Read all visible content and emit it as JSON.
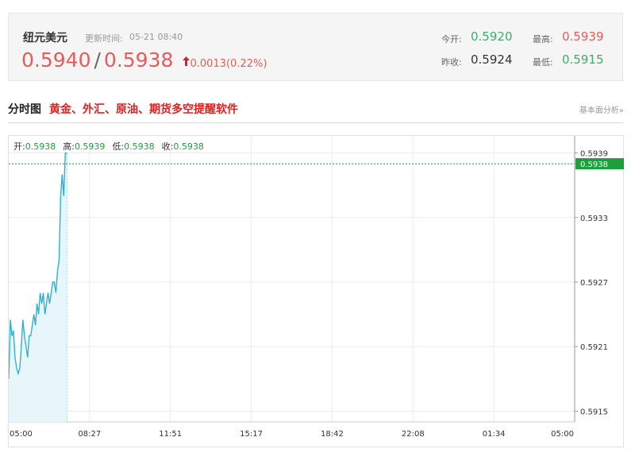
{
  "quote": {
    "name": "纽元美元",
    "update_label": "更新时间:",
    "update_time": "05-21 08:40",
    "bid": "0.5940",
    "slash": "/",
    "ask": "0.5938",
    "change": "0.0013(0.22%)",
    "direction_icon": "arrow-up-icon",
    "open_label": "今开:",
    "open": "0.5920",
    "prev_close_label": "昨收:",
    "prev_close": "0.5924",
    "high_label": "最高:",
    "high": "0.5939",
    "low_label": "最低:",
    "low": "0.5915"
  },
  "section": {
    "title": "分时图",
    "ad_text": "黄金、外汇、原油、期货多空提醒软件",
    "link": "基本面分析»"
  },
  "ohlc": {
    "open_label": "开:",
    "open": "0.5938",
    "high_label": "高:",
    "high": "0.5939",
    "low_label": "低:",
    "low": "0.5938",
    "close_label": "收:",
    "close": "0.5938"
  },
  "colors": {
    "up": "#e65c5c",
    "down": "#3dad6a",
    "line": "#2bb3d1",
    "fill": "#e6f6fb",
    "current_price_tag": "#1aa13b"
  },
  "chart_data": {
    "type": "area",
    "title": "",
    "xlabel": "",
    "ylabel": "",
    "x_ticks": [
      "05:00",
      "08:27",
      "11:51",
      "15:17",
      "18:42",
      "22:08",
      "01:34",
      "05:00"
    ],
    "y_ticks": [
      "0.5939",
      "0.5933",
      "0.5927",
      "0.5921",
      "0.5915"
    ],
    "ylim": [
      0.5914,
      0.594
    ],
    "grid": true,
    "current_price": "0.5938",
    "x_minutes": [
      0,
      4,
      8,
      12,
      16,
      20,
      24,
      28,
      32,
      36,
      40,
      44,
      48,
      52,
      56,
      60,
      64,
      68,
      72,
      76,
      80,
      84,
      88,
      92,
      96,
      100,
      104,
      108,
      112,
      116,
      120,
      124,
      128,
      132,
      136,
      140,
      144,
      148,
      152,
      156,
      160,
      164,
      168,
      172,
      176,
      180,
      184,
      188,
      192,
      196,
      200,
      204,
      208,
      212,
      216,
      220,
      224
    ],
    "values": [
      0.5918,
      0.59235,
      0.5922,
      0.59225,
      0.592,
      0.5919,
      0.59185,
      0.5919,
      0.5921,
      0.59235,
      0.5922,
      0.5921,
      0.592,
      0.5922,
      0.5922,
      0.5923,
      0.5924,
      0.5923,
      0.5925,
      0.5924,
      0.5926,
      0.5925,
      0.5926,
      0.5924,
      0.5925,
      0.5926,
      0.5925,
      0.5926,
      0.5927,
      0.5927,
      0.5926,
      0.5928,
      0.5929,
      0.5935,
      0.5937,
      0.5935,
      0.5939,
      0.5939,
      0.5938,
      0.5938,
      0.5938,
      0.5938,
      0.5938,
      0.5938,
      0.5938,
      0.5938,
      0.5938,
      0.5938,
      0.5938,
      0.5938,
      0.5938,
      0.5938,
      0.5938,
      0.5938,
      0.5938,
      0.5938,
      0.5938
    ],
    "visible_points": 38
  }
}
